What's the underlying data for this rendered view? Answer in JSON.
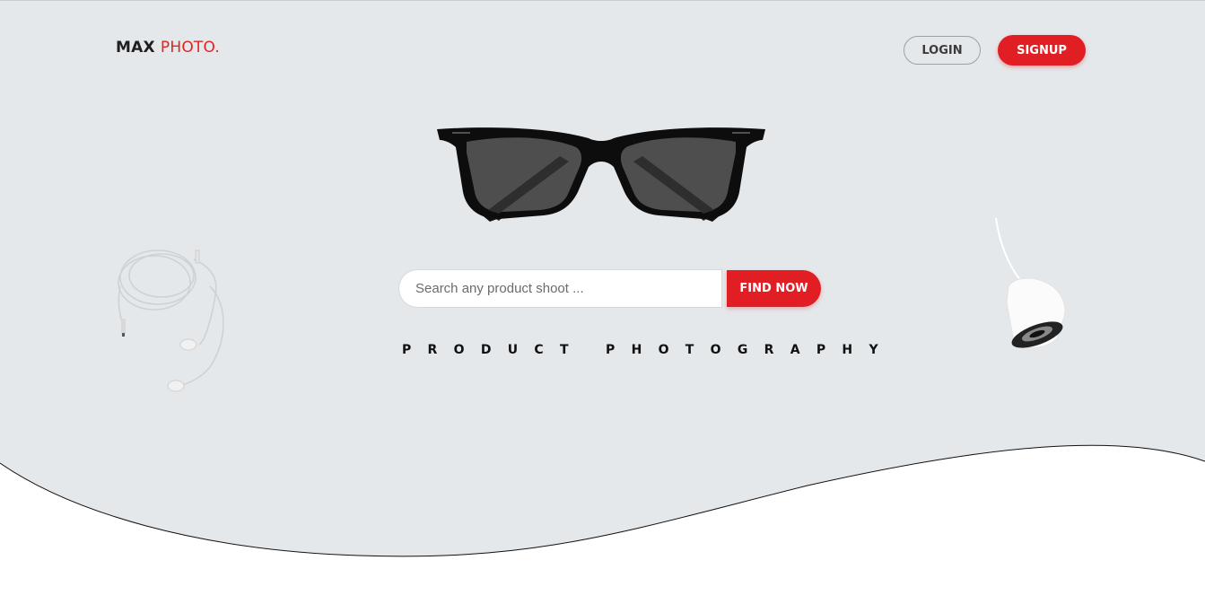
{
  "brand": {
    "name_part1": "MAX",
    "name_part2": "PHOTO."
  },
  "nav": {
    "login_label": "LOGIN",
    "signup_label": "SIGNUP"
  },
  "search": {
    "placeholder": "Search any product shoot ...",
    "value": "",
    "button_label": "FIND NOW"
  },
  "hero": {
    "tagline": "PRODUCT PHOTOGRAPHY"
  },
  "colors": {
    "accent": "#e11e24",
    "hero_background": "#e5e8eb",
    "page_background": "#ffffff",
    "text_dark": "#1f1f1f"
  },
  "icons": {
    "glasses": "eyeglasses-image",
    "earphones": "earphones-image",
    "lamp": "pendant-lamp-image"
  }
}
